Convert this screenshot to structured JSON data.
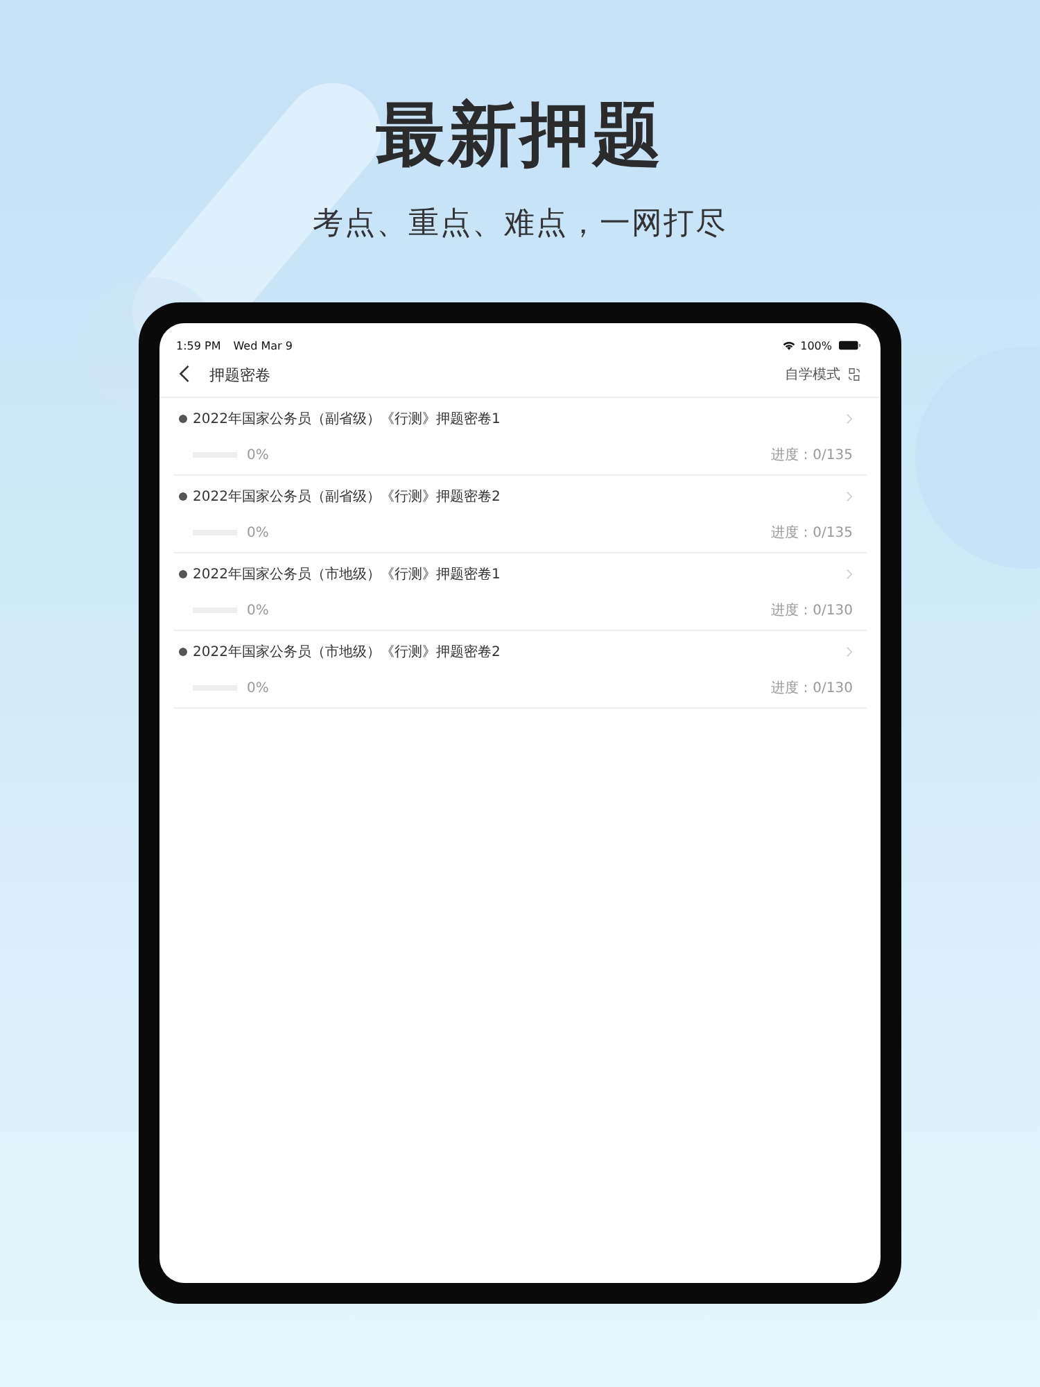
{
  "headline": "最新押题",
  "subtitle": "考点、重点、难点，一网打尽",
  "status_bar": {
    "time": "1:59 PM",
    "date": "Wed Mar 9",
    "battery": "100%"
  },
  "nav": {
    "title": "押题密卷",
    "mode": "自学模式"
  },
  "papers": [
    {
      "title": "2022年国家公务员（副省级）《行测》押题密卷1",
      "level": 0,
      "percent": "0%",
      "progress": "进度：0/135"
    },
    {
      "title": "2022年国家公务员（副省级）《行测》押题密卷2",
      "level": 0,
      "percent": "0%",
      "progress": "进度：0/135"
    },
    {
      "title": "2022年国家公务员（市地级）《行测》押题密卷1",
      "level": 0,
      "percent": "0%",
      "progress": "进度：0/130"
    },
    {
      "title": "2022年国家公务员（市地级）《行测》押题密卷2",
      "level": 0,
      "percent": "0%",
      "progress": "进度：0/130"
    }
  ]
}
